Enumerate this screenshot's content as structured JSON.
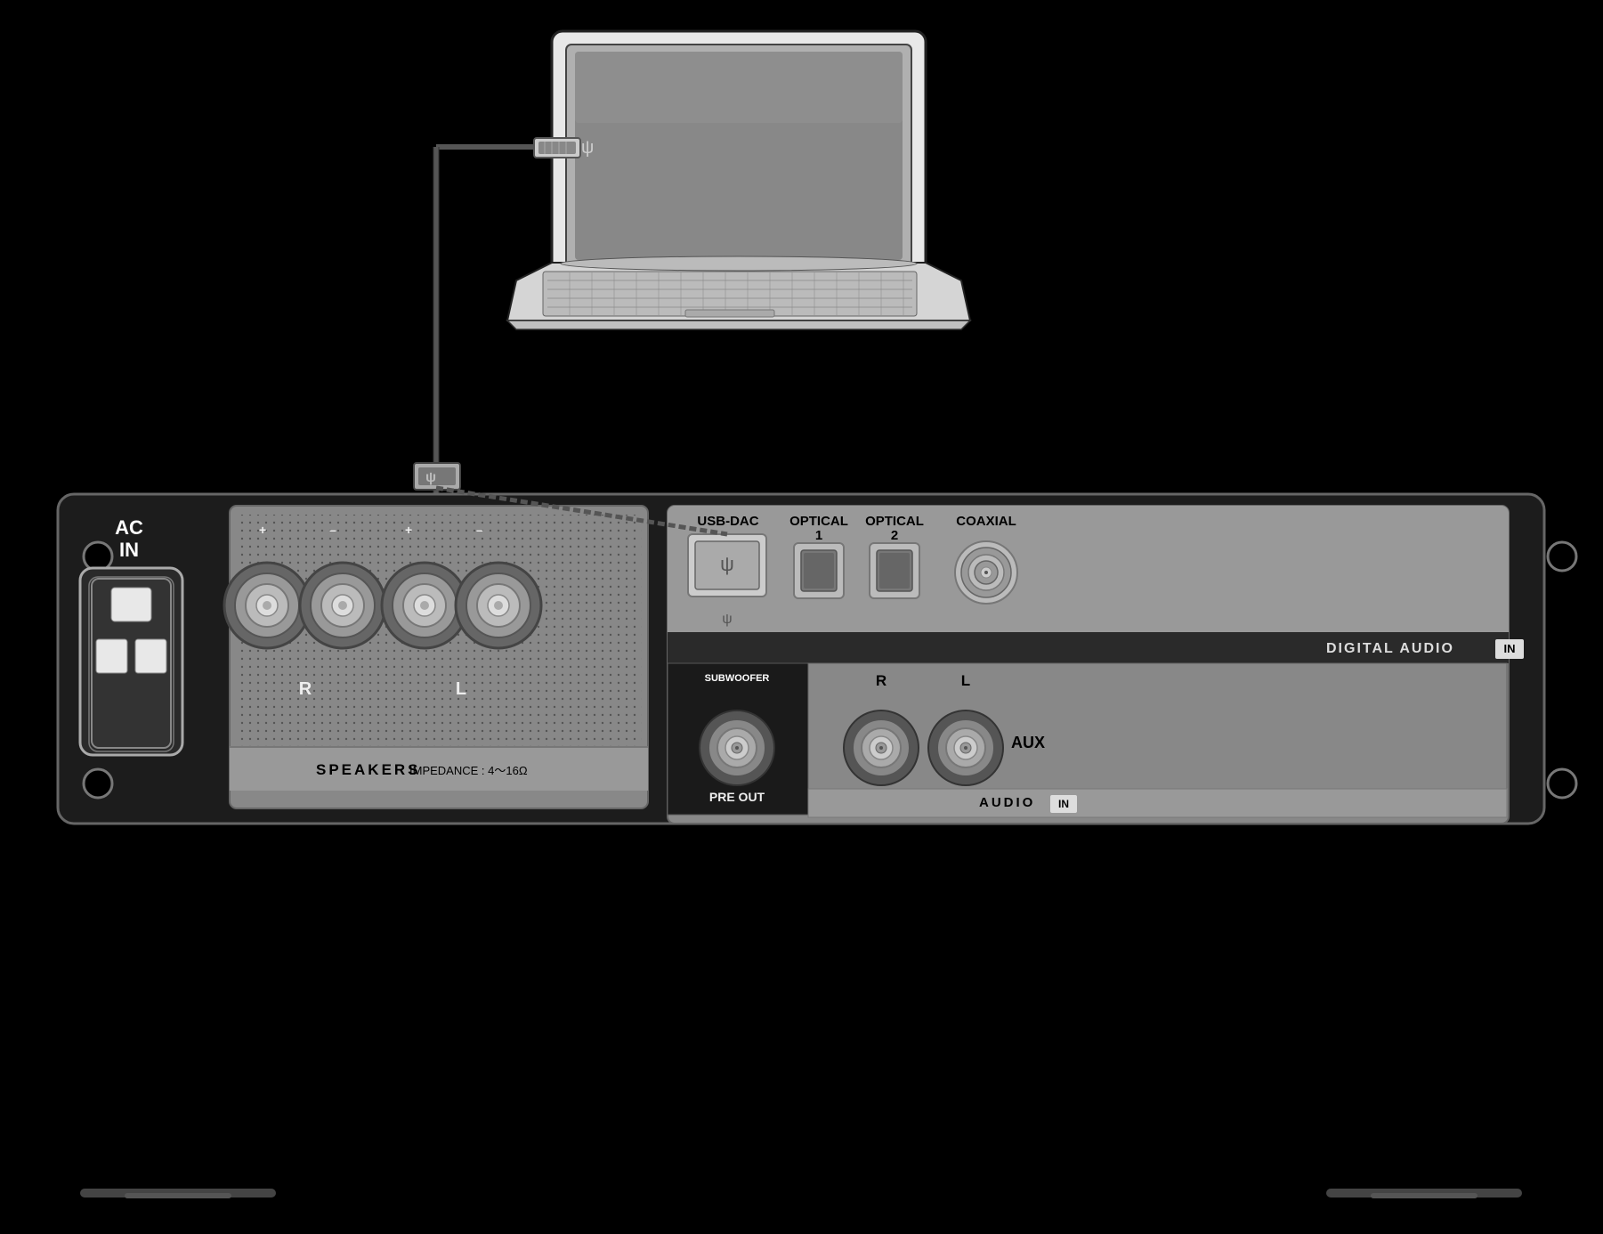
{
  "background_color": "#000000",
  "laptop": {
    "alt": "Laptop computer illustration"
  },
  "usb_cable": {
    "description": "USB cable connecting laptop to amplifier"
  },
  "ac_in": {
    "label": "AC\nIN"
  },
  "speakers_section": {
    "label": "SPEAKERS",
    "impedance": "IMPEDANCE : 4～16Ω",
    "channels": {
      "right": "R",
      "left": "L"
    },
    "poles": {
      "positive": "+",
      "negative": "–"
    }
  },
  "digital_audio": {
    "section_label": "DIGITAL AUDIO",
    "in_badge": "IN",
    "inputs": [
      {
        "label": "USB-DAC",
        "type": "usb"
      },
      {
        "label": "OPTICAL\n1",
        "type": "optical"
      },
      {
        "label": "OPTICAL\n2",
        "type": "optical"
      },
      {
        "label": "COAXIAL",
        "type": "coaxial"
      }
    ],
    "usb_symbol": "ψ"
  },
  "pre_out": {
    "top_label": "SUBWOOFER",
    "bottom_label": "PRE OUT"
  },
  "audio_in": {
    "label": "AUDIO",
    "in_badge": "IN",
    "channels": {
      "right": "R",
      "left": "L"
    },
    "aux_label": "AUX"
  }
}
